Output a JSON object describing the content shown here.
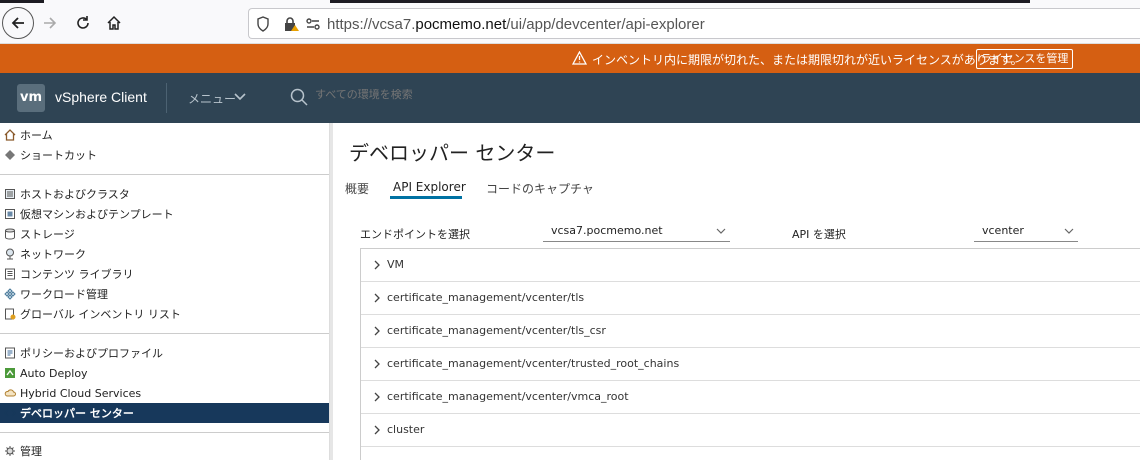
{
  "browser": {
    "url_prefix": "https://vcsa7.",
    "url_domain": "pocmemo.net",
    "url_path": "/ui/app/devcenter/api-explorer"
  },
  "banner": {
    "message": "インベントリ内に期限が切れた、または期限切れが近いライセンスがあります。",
    "button_label": "ライセンスを管理"
  },
  "header": {
    "logo": "vm",
    "title": "vSphere Client",
    "menu_label": "メニュー",
    "search_placeholder": "すべての環境を検索"
  },
  "sidebar": {
    "items": [
      {
        "label": "ホーム"
      },
      {
        "label": "ショートカット"
      },
      {
        "label": "ホストおよびクラスタ"
      },
      {
        "label": "仮想マシンおよびテンプレート"
      },
      {
        "label": "ストレージ"
      },
      {
        "label": "ネットワーク"
      },
      {
        "label": "コンテンツ ライブラリ"
      },
      {
        "label": "ワークロード管理"
      },
      {
        "label": "グローバル インベントリ リスト"
      },
      {
        "label": "ポリシーおよびプロファイル"
      },
      {
        "label": "Auto Deploy"
      },
      {
        "label": "Hybrid Cloud Services"
      },
      {
        "label": "デベロッパー センター"
      },
      {
        "label": "管理"
      }
    ]
  },
  "main": {
    "title": "デベロッパー センター",
    "tabs": [
      {
        "label": "概要"
      },
      {
        "label": "API Explorer"
      },
      {
        "label": "コードのキャプチャ"
      }
    ],
    "endpoint_label": "エンドポイントを選択",
    "endpoint_value": "vcsa7.pocmemo.net",
    "api_label": "API を選択",
    "api_value": "vcenter",
    "api_rows": [
      {
        "label": "VM"
      },
      {
        "label": "certificate_management/vcenter/tls"
      },
      {
        "label": "certificate_management/vcenter/tls_csr"
      },
      {
        "label": "certificate_management/vcenter/trusted_root_chains"
      },
      {
        "label": "certificate_management/vcenter/vmca_root"
      },
      {
        "label": "cluster"
      }
    ]
  }
}
